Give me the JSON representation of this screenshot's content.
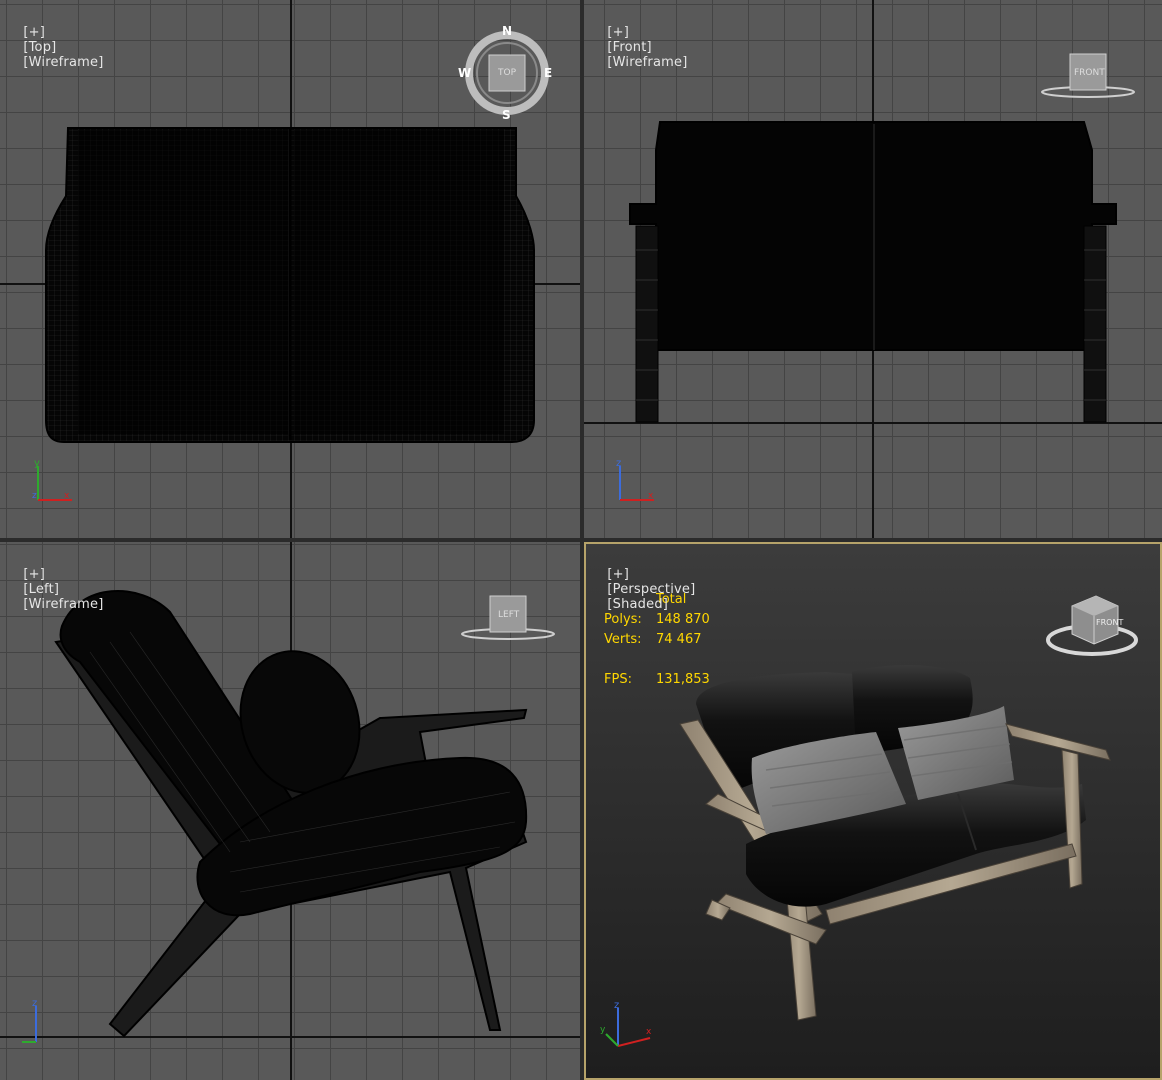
{
  "viewports": {
    "top": {
      "label_plus": "[+]",
      "label_view": "[Top]",
      "label_mode": "[Wireframe]",
      "cube_face": "TOP",
      "compass": {
        "n": "N",
        "s": "S",
        "e": "E",
        "w": "W"
      }
    },
    "front": {
      "label_plus": "[+]",
      "label_view": "[Front]",
      "label_mode": "[Wireframe]",
      "cube_face": "FRONT"
    },
    "left": {
      "label_plus": "[+]",
      "label_view": "[Left]",
      "label_mode": "[Wireframe]",
      "cube_face": "LEFT"
    },
    "perspective": {
      "label_plus": "[+]",
      "label_view": "[Perspective]",
      "label_mode": "[Shaded]",
      "cube_face": "FRONT",
      "active_border_color": "#b6a36a"
    }
  },
  "stats": {
    "header": "Total",
    "polys_label": "Polys:",
    "polys_value": "148 870",
    "verts_label": "Verts:",
    "verts_value": "74 467",
    "fps_label": "FPS:",
    "fps_value": "131,853",
    "color": "#ffd700"
  },
  "axes": {
    "x": "x",
    "y": "y",
    "z": "z"
  }
}
